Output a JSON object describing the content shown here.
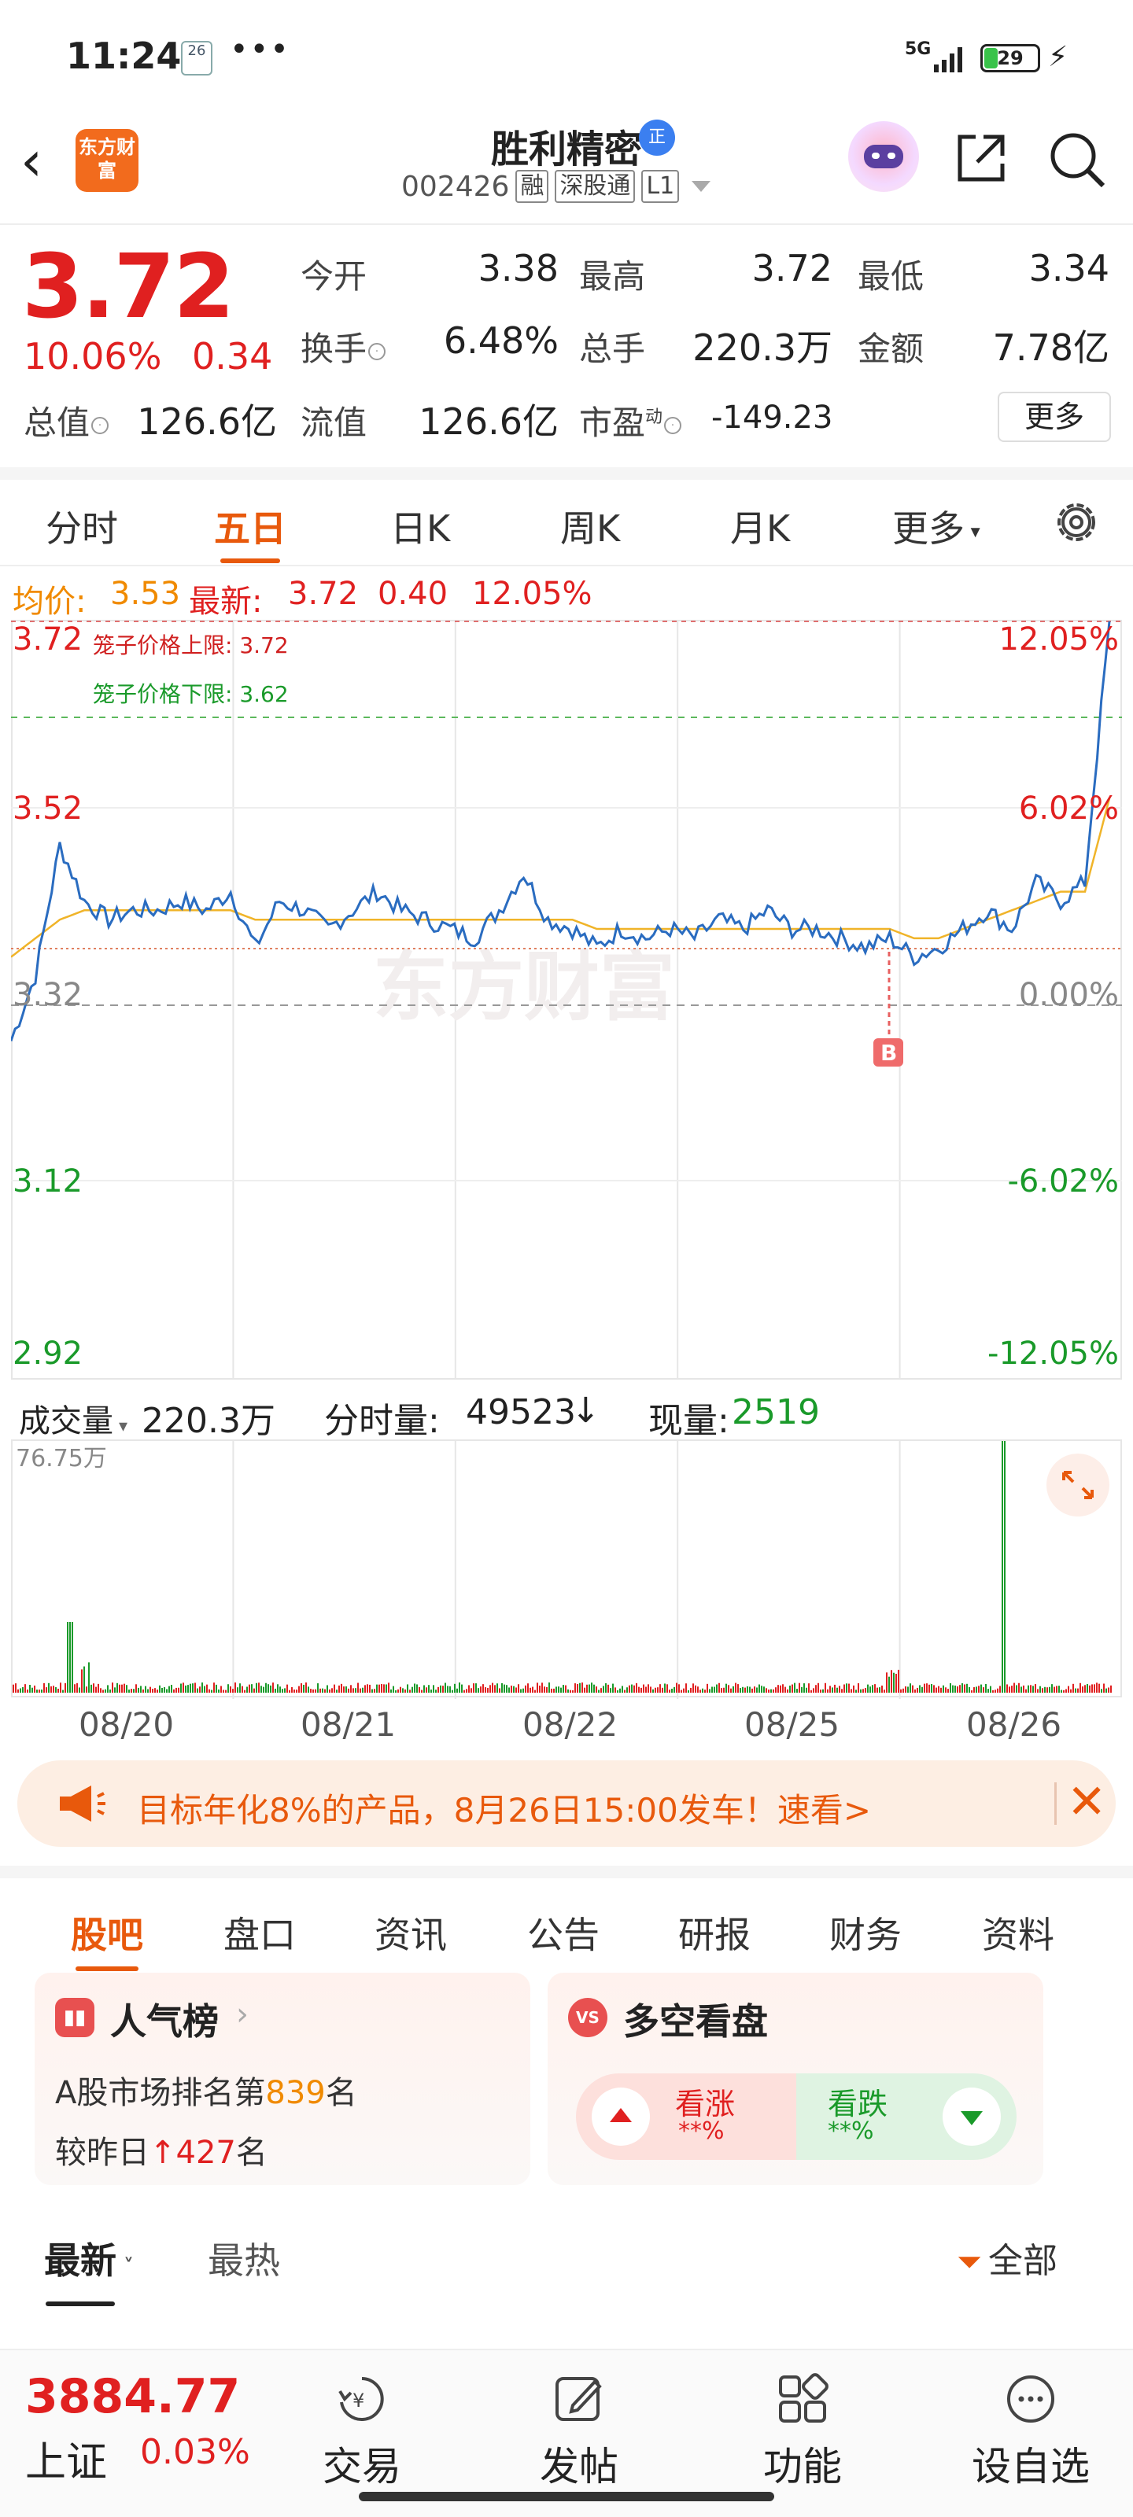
{
  "status_bar": {
    "time": "11:24",
    "calendar_day": "26",
    "dots": "•••",
    "network": "5G",
    "battery": "29"
  },
  "header": {
    "logo_text": "东方财富",
    "stock_name": "胜利精密",
    "badge": "正",
    "code": "002426",
    "tags": [
      "融",
      "深股通",
      "L1"
    ]
  },
  "quote": {
    "price": "3.72",
    "change_pct": "10.06%",
    "change_val": "0.34",
    "open_label": "今开",
    "open": "3.38",
    "high_label": "最高",
    "high": "3.72",
    "low_label": "最低",
    "low": "3.34",
    "turnover_label": "换手",
    "turnover": "6.48%",
    "volume_label": "总手",
    "volume": "220.3万",
    "amount_label": "金额",
    "amount": "7.78亿",
    "mktcap_label": "总值",
    "mktcap": "126.6亿",
    "float_label": "流值",
    "float_cap": "126.6亿",
    "pe_label": "市盈",
    "pe_sup": "动",
    "pe": "-149.23",
    "more_button": "更多"
  },
  "chart_tabs": [
    "分时",
    "五日",
    "日K",
    "周K",
    "月K",
    "更多"
  ],
  "active_chart_tab": "五日",
  "info_line": {
    "avg_label": "均价:",
    "avg": "3.53",
    "latest_label": "最新:",
    "latest": "3.72",
    "chg": "0.40",
    "chg_pct": "12.05%"
  },
  "chart_labels": {
    "cage_upper": "笼子价格上限: 3.72",
    "cage_lower": "笼子价格下限: 3.62",
    "watermark": "东方财富",
    "b_marker": "B"
  },
  "chart_data": {
    "type": "line",
    "title": "",
    "x": [
      "08/20",
      "08/21",
      "08/22",
      "08/25",
      "08/26"
    ],
    "y_left_ticks": [
      "3.72",
      "3.52",
      "3.32",
      "3.12",
      "2.92"
    ],
    "y_right_ticks": [
      "12.05%",
      "6.02%",
      "0.00%",
      "-6.02%",
      "-12.05%"
    ],
    "ylim": [
      2.92,
      3.72
    ],
    "prev_close": 3.32,
    "series": [
      {
        "name": "",
        "values": [
          3.27,
          3.34,
          3.48,
          3.42,
          3.4,
          3.41,
          3.41,
          3.42,
          3.41,
          3.43,
          3.37,
          3.42,
          3.41,
          3.39,
          3.41,
          3.43,
          3.41,
          3.4,
          3.39,
          3.38,
          3.41,
          3.45,
          3.4,
          3.39,
          3.37,
          3.39,
          3.38,
          3.39,
          3.38,
          3.4,
          3.39,
          3.41,
          3.39,
          3.39,
          3.38,
          3.37,
          3.38,
          3.36,
          3.37,
          3.39,
          3.41,
          3.39,
          3.44,
          3.42,
          3.44,
          3.72
        ]
      },
      {
        "name": "",
        "values": [
          3.36,
          3.38,
          3.4,
          3.41,
          3.41,
          3.41,
          3.41,
          3.41,
          3.41,
          3.41,
          3.4,
          3.4,
          3.4,
          3.4,
          3.4,
          3.4,
          3.4,
          3.4,
          3.4,
          3.4,
          3.4,
          3.4,
          3.4,
          3.4,
          3.39,
          3.39,
          3.39,
          3.39,
          3.39,
          3.39,
          3.39,
          3.39,
          3.39,
          3.39,
          3.39,
          3.39,
          3.39,
          3.38,
          3.38,
          3.39,
          3.4,
          3.41,
          3.42,
          3.43,
          3.43,
          3.53
        ]
      }
    ],
    "grid": true
  },
  "volume": {
    "label": "成交量",
    "total": "220.3万",
    "minute_label": "分时量:",
    "minute": "49523",
    "arrow": "↓",
    "now_label": "现量:",
    "now": "2519",
    "max_label": "76.75万"
  },
  "promo": {
    "text": "目标年化8%的产品，8月26日15:00发车！速看>"
  },
  "section_tabs": [
    "股吧",
    "盘口",
    "资讯",
    "公告",
    "研报",
    "财务",
    "资料"
  ],
  "active_section_tab": "股吧",
  "popularity_card": {
    "title": "人气榜",
    "line1_pre": "A股市场排名第",
    "rank": "839",
    "line1_post": "名",
    "line2_pre": "较昨日",
    "delta": "427",
    "line2_post": "名"
  },
  "vote_card": {
    "title": "多空看盘",
    "icon": "VS",
    "up_label": "看涨",
    "up_value": "**%",
    "down_label": "看跌",
    "down_value": "**%"
  },
  "sort_row": {
    "newest": "最新",
    "hottest": "最热",
    "filter": "全部"
  },
  "bottom_bar": {
    "index_value": "3884.77",
    "index_name": "上证",
    "index_change": "0.03%",
    "nav": [
      "交易",
      "发帖",
      "功能",
      "设自选"
    ]
  },
  "colors": {
    "up": "#e02020",
    "down": "#1a9a2a",
    "accent": "#e8590c",
    "price_line": "#2a6cc0",
    "avg_line": "#f0b429"
  }
}
